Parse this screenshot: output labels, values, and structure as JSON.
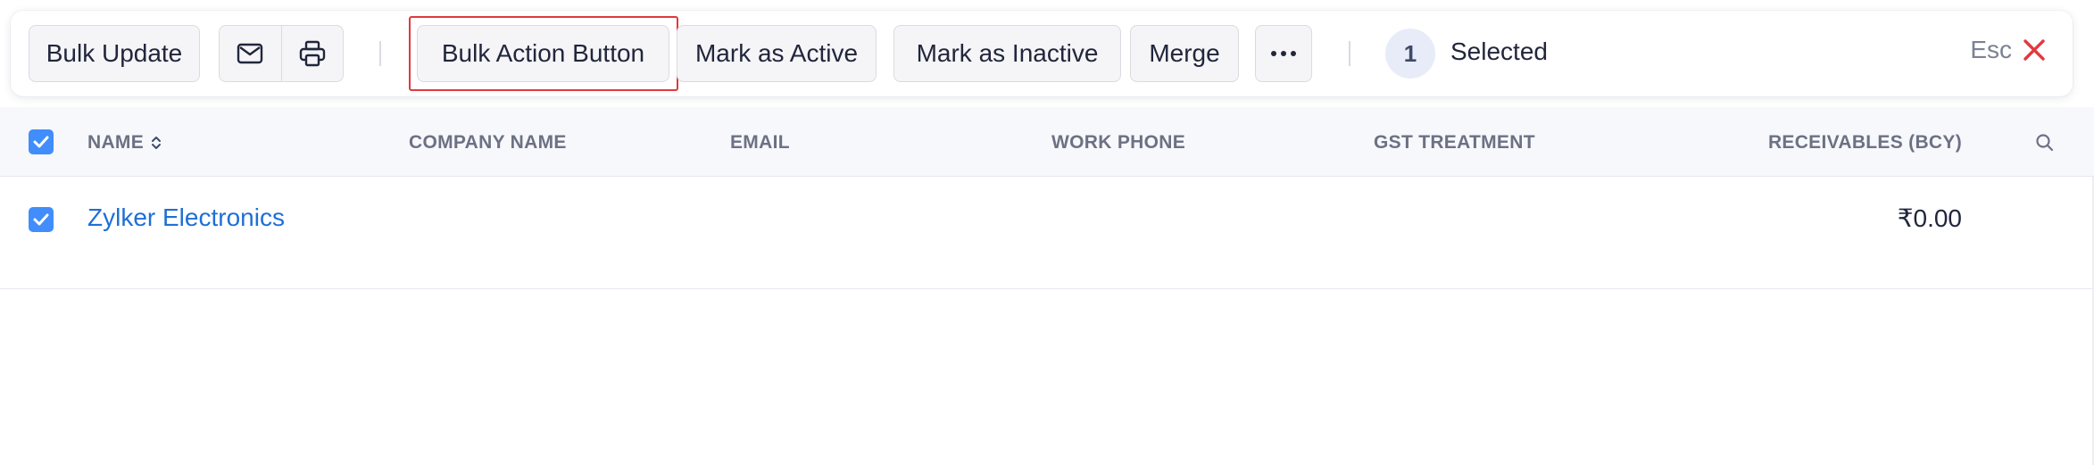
{
  "toolbar": {
    "bulk_update_label": "Bulk Update",
    "email_icon": "mail-icon",
    "print_icon": "printer-icon",
    "bulk_action_label": "Bulk Action Button",
    "mark_active_label": "Mark as Active",
    "mark_inactive_label": "Mark as Inactive",
    "merge_label": "Merge",
    "more_icon": "ellipsis-icon",
    "selected_count": "1",
    "selected_label": "Selected",
    "esc_label": "Esc",
    "close_icon": "close-icon",
    "highlight_color": "#e0393e"
  },
  "table": {
    "columns": [
      "NAME",
      "COMPANY NAME",
      "EMAIL",
      "WORK PHONE",
      "GST TREATMENT",
      "RECEIVABLES (BCY)"
    ],
    "sort_icon": "sort-icon",
    "search_icon": "search-icon",
    "rows": [
      {
        "checked": true,
        "name": "Zylker Electronics",
        "company_name": "",
        "email": "",
        "work_phone": "",
        "gst_treatment": "",
        "receivables": "₹0.00"
      }
    ]
  },
  "colors": {
    "accent": "#408dfb",
    "link": "#1f6fd6",
    "close": "#e0393e"
  }
}
